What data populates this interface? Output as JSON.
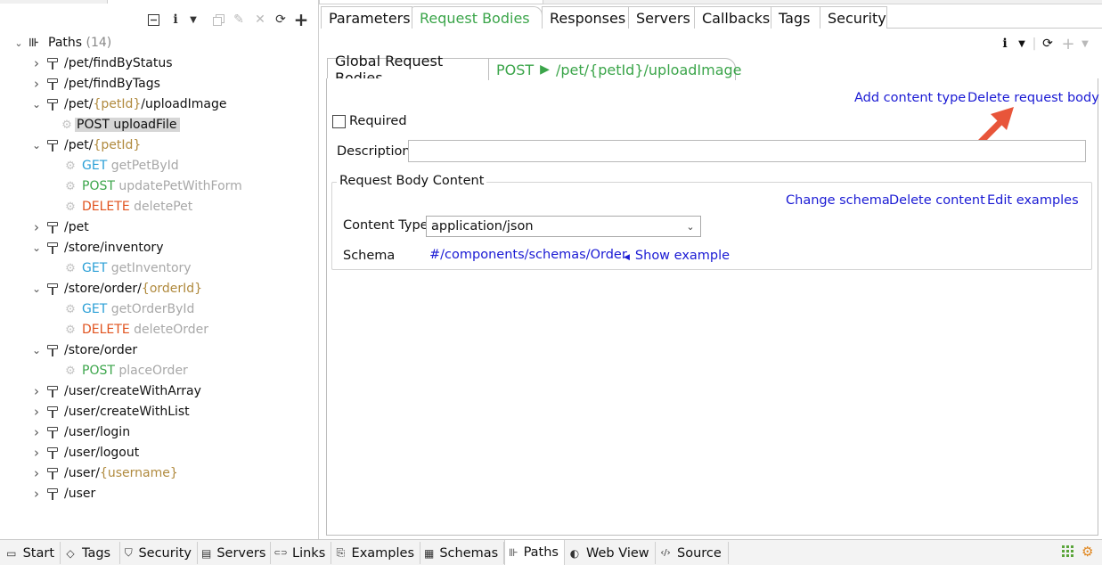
{
  "tree": {
    "root_label": "Paths",
    "root_count": "(14)",
    "items": [
      {
        "kind": "path",
        "indent": 0,
        "expanded": false,
        "parts": [
          {
            "t": "/pet/findByStatus"
          }
        ]
      },
      {
        "kind": "path",
        "indent": 0,
        "expanded": false,
        "parts": [
          {
            "t": "/pet/findByTags"
          }
        ]
      },
      {
        "kind": "path",
        "indent": 0,
        "expanded": true,
        "parts": [
          {
            "t": "/pet/"
          },
          {
            "t": "{petId}",
            "c": "ph"
          },
          {
            "t": "/uploadImage"
          }
        ]
      },
      {
        "kind": "op",
        "selected": true,
        "method": "POST",
        "mclass": "",
        "name": "uploadFile"
      },
      {
        "kind": "path",
        "indent": 0,
        "expanded": true,
        "parts": [
          {
            "t": "/pet/"
          },
          {
            "t": "{petId}",
            "c": "ph"
          }
        ]
      },
      {
        "kind": "op",
        "method": "GET",
        "mclass": "m-get",
        "name": "getPetById"
      },
      {
        "kind": "op",
        "method": "POST",
        "mclass": "m-post",
        "name": "updatePetWithForm"
      },
      {
        "kind": "op",
        "method": "DELETE",
        "mclass": "m-del",
        "name": "deletePet"
      },
      {
        "kind": "path",
        "indent": 0,
        "expanded": false,
        "parts": [
          {
            "t": "/pet"
          }
        ]
      },
      {
        "kind": "path",
        "indent": 0,
        "expanded": true,
        "parts": [
          {
            "t": "/store/inventory"
          }
        ]
      },
      {
        "kind": "op",
        "method": "GET",
        "mclass": "m-get",
        "name": "getInventory"
      },
      {
        "kind": "path",
        "indent": 0,
        "expanded": true,
        "parts": [
          {
            "t": "/store/order/"
          },
          {
            "t": "{orderId}",
            "c": "ph"
          }
        ]
      },
      {
        "kind": "op",
        "method": "GET",
        "mclass": "m-get",
        "name": "getOrderById"
      },
      {
        "kind": "op",
        "method": "DELETE",
        "mclass": "m-del",
        "name": "deleteOrder"
      },
      {
        "kind": "path",
        "indent": 0,
        "expanded": true,
        "parts": [
          {
            "t": "/store/order"
          }
        ]
      },
      {
        "kind": "op",
        "method": "POST",
        "mclass": "m-post",
        "name": "placeOrder"
      },
      {
        "kind": "path",
        "indent": 0,
        "expanded": false,
        "parts": [
          {
            "t": "/user/createWithArray"
          }
        ]
      },
      {
        "kind": "path",
        "indent": 0,
        "expanded": false,
        "parts": [
          {
            "t": "/user/createWithList"
          }
        ]
      },
      {
        "kind": "path",
        "indent": 0,
        "expanded": false,
        "parts": [
          {
            "t": "/user/login"
          }
        ]
      },
      {
        "kind": "path",
        "indent": 0,
        "expanded": false,
        "parts": [
          {
            "t": "/user/logout"
          }
        ]
      },
      {
        "kind": "path",
        "indent": 0,
        "expanded": false,
        "parts": [
          {
            "t": "/user/"
          },
          {
            "t": "{username}",
            "c": "ph"
          }
        ]
      },
      {
        "kind": "path",
        "indent": 0,
        "expanded": false,
        "parts": [
          {
            "t": "/user"
          }
        ]
      }
    ]
  },
  "main_tabs": [
    "Parameters",
    "Request Bodies",
    "Responses",
    "Servers",
    "Callbacks",
    "Tags",
    "Security"
  ],
  "sub_tabs": {
    "global": "Global Request Bodies",
    "active_method": "POST",
    "active_path": "/pet/{petId}/uploadImage"
  },
  "actions": {
    "add_content_type": "Add content type",
    "delete_request_body": "Delete request body"
  },
  "form": {
    "required_label": "Required",
    "description_label": "Description",
    "description_value": ""
  },
  "content_group": {
    "legend": "Request Body Content",
    "change_schema": "Change schema",
    "delete_content": "Delete content",
    "edit_examples": "Edit examples",
    "content_type_label": "Content Type",
    "content_type_value": "application/json",
    "schema_label": "Schema",
    "schema_ref": "#/components/schemas/Order",
    "show_example": "Show example"
  },
  "bottom_tabs": [
    "Start",
    "Tags",
    "Security",
    "Servers",
    "Links",
    "Examples",
    "Schemas",
    "Paths",
    "Web View",
    "Source"
  ],
  "bottom_active": "Paths",
  "colors": {
    "accent_green": "#3ba54a",
    "link_blue": "#1a1ad4",
    "arrow": "#e8553a"
  }
}
